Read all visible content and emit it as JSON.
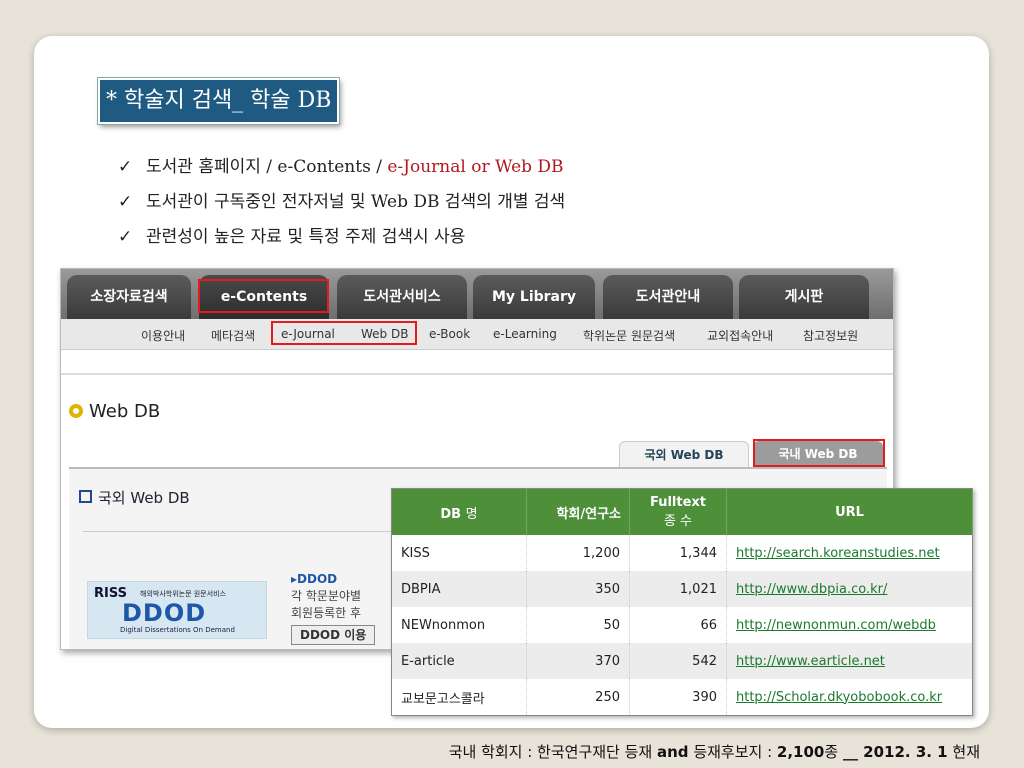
{
  "title": "* 학술지 검색_ 학술 DB",
  "bullets": [
    {
      "check": "✓",
      "text": "도서관 홈페이지 / e-Contents / ",
      "highlight": "e-Journal or Web DB"
    },
    {
      "check": "✓",
      "text": "도서관이 구독중인 전자저널 및 Web  DB 검색의 개별 검색",
      "highlight": ""
    },
    {
      "check": "✓",
      "text": "관련성이 높은 자료 및 특정 주제 검색시 사용",
      "highlight": ""
    }
  ],
  "site": {
    "tabs": [
      "소장자료검색",
      "e-Contents",
      "도서관서비스",
      "My Library",
      "도서관안내",
      "게시판"
    ],
    "subnav": [
      "이용안내",
      "메타검색",
      "e-Journal",
      "Web DB",
      "e-Book",
      "e-Learning",
      "학위논문 원문검색",
      "교외접속안내",
      "참고정보원"
    ],
    "page_title": "Web DB",
    "db_tabs": [
      "국외 Web DB",
      "국내 Web DB"
    ],
    "section_title": "국외 Web DB",
    "logo": {
      "riss": "RISS",
      "riss_sub": "해외박사학위논문 원문서비스",
      "ddod": "DDOD",
      "ddod_sub": "Digital Dissertations On Demand"
    },
    "ddod_heading": "▸DDOD",
    "ddod_line1": "각 학문분야별",
    "ddod_line2": "회원등록한 후",
    "ddod_button": "DDOD 이용"
  },
  "table": {
    "headers": {
      "db": "DB",
      "db_suffix": "명",
      "society": "학회/연구소",
      "fulltext": "Fulltext",
      "fulltext_sub": "종 수",
      "url": "URL"
    },
    "rows": [
      {
        "name": "KISS",
        "society": "1,200",
        "fulltext": "1,344",
        "url": "http://search.koreanstudies.net"
      },
      {
        "name": "DBPIA",
        "society": "350",
        "fulltext": "1,021",
        "url": "http://www.dbpia.co.kr/"
      },
      {
        "name": "NEWnonmon",
        "society": "50",
        "fulltext": "66",
        "url": "http://newnonmun.com/webdb"
      },
      {
        "name": "E-article",
        "society": "370",
        "fulltext": "542",
        "url": "http://www.earticle.net"
      },
      {
        "name": "교보문고스콜라",
        "society": "250",
        "fulltext": "390",
        "url": "http://Scholar.dkyobobook.co.kr"
      }
    ]
  },
  "footer": {
    "p1": "국내 학회지 : 한국연구재단 등재 ",
    "and": "and",
    "p2": " 등재후보지 : ",
    "count": "2,100",
    "p3": "종 ",
    "blank": "__",
    "date": " 2012. 3. 1",
    "p4": " 현재"
  },
  "colors": {
    "title_bg": "#1e5a82",
    "table_header": "#4e8f3a",
    "highlight_red": "#b0181e",
    "box_red": "#e21b1b"
  }
}
